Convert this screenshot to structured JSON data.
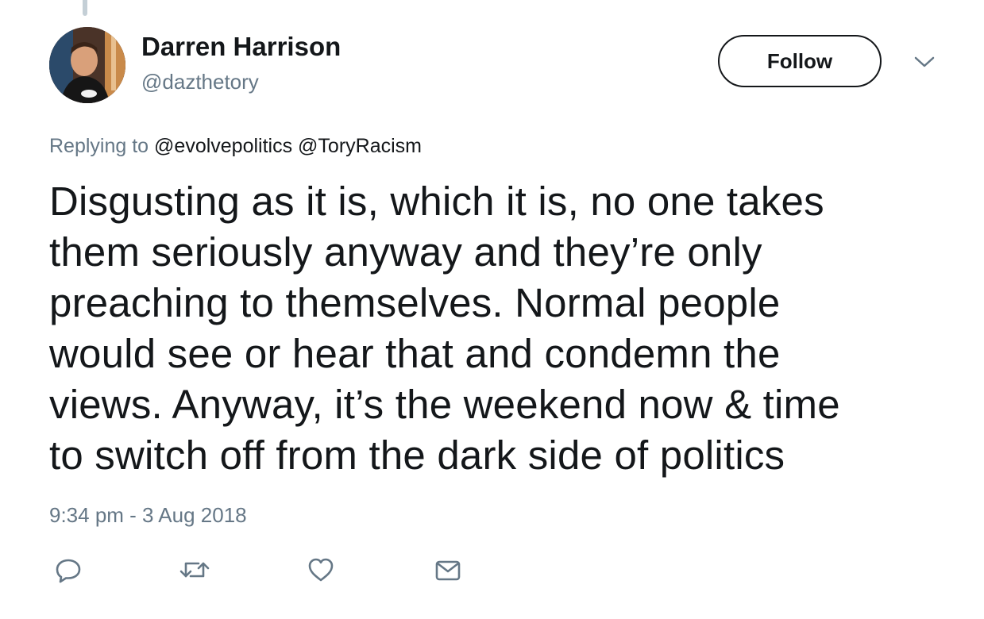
{
  "author": {
    "display_name": "Darren Harrison",
    "handle": "@dazthetory"
  },
  "header": {
    "follow_label": "Follow"
  },
  "reply_context": {
    "prefix": "Replying to",
    "mentions": [
      "@evolvepolitics",
      "@ToryRacism"
    ]
  },
  "tweet": {
    "lines": [
      "Disgusting as it is, which it is, no one takes",
      "them seriously anyway and they’re only",
      "preaching to themselves. Normal people",
      "would see or hear that and condemn the",
      "views. Anyway, it’s the weekend now & time",
      "to switch off from the dark side of politics"
    ],
    "timestamp": "9:34 pm - 3 Aug 2018"
  },
  "actions": {
    "icons": [
      "reply-icon",
      "retweet-icon",
      "like-icon",
      "direct-message-icon"
    ]
  },
  "colors": {
    "text_primary": "#14171a",
    "text_secondary": "#657786",
    "icon_gray": "#657786",
    "thread_line": "#c4cfd6"
  }
}
